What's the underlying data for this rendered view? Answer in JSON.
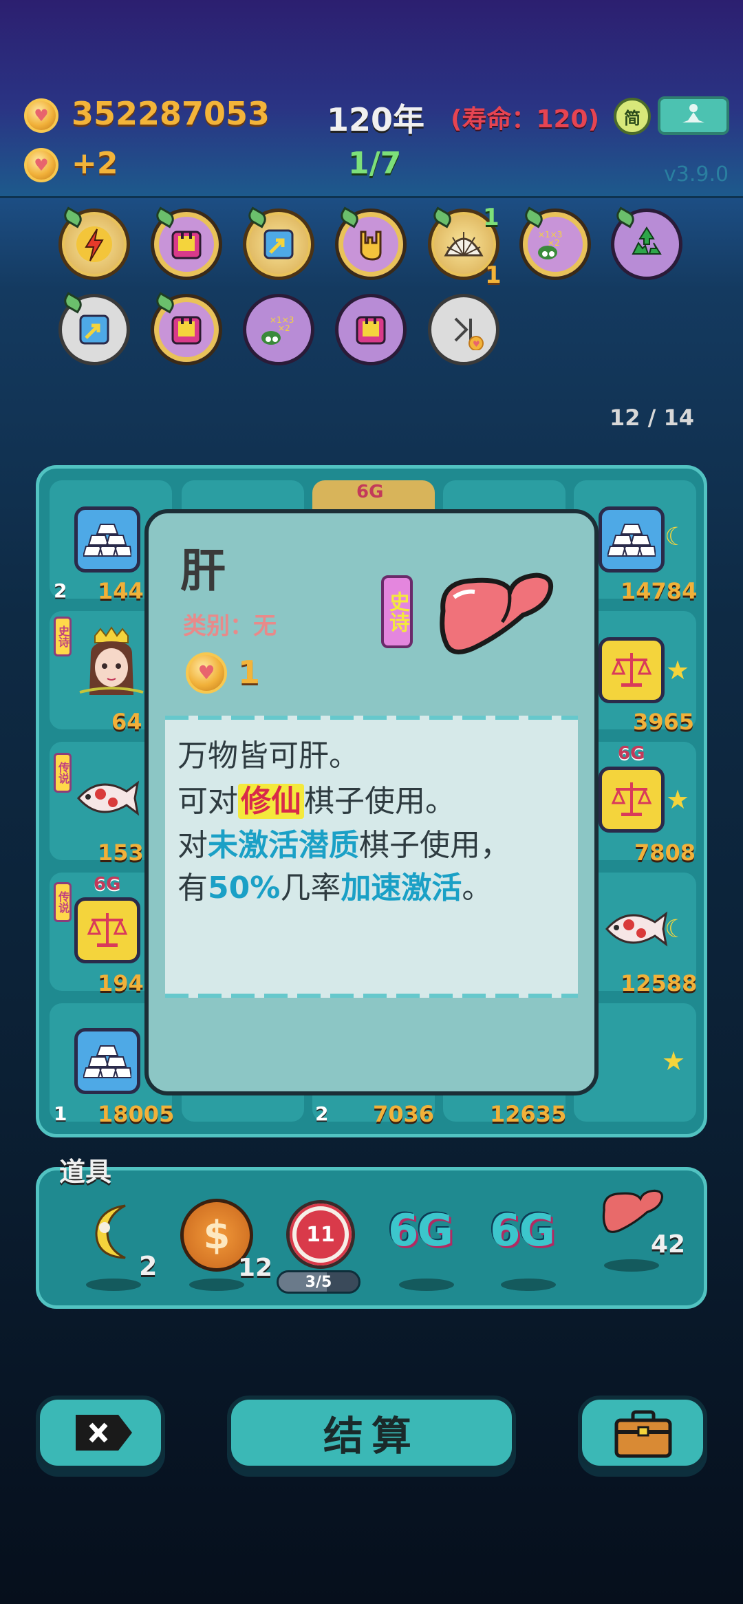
{
  "header": {
    "coins": "352287053",
    "coins_delta": "+2",
    "year": "120年",
    "lifespan": "(寿命：120)",
    "progress": "1/7",
    "lang_toggle": "简",
    "version": "v3.9.0"
  },
  "skills": {
    "shell_top_count": "1",
    "shell_bottom_count": "1"
  },
  "board": {
    "page": "12 / 14",
    "cells": {
      "r1c1_small": "2",
      "r1c1_num": "144",
      "r1c3_badge": "6G",
      "r1c5_num": "14784",
      "r2c1_num": "64",
      "r2c1_tag": "史诗",
      "r2c5_num": "3965",
      "r3c1_num": "153",
      "r3c1_tag": "传说",
      "r3c5_num": "7808",
      "r3c5_badge": "6G",
      "r4c1_num": "194",
      "r4c1_tag": "传说",
      "r4c1_badge": "6G",
      "r4c5_num": "12588",
      "r5c1_small": "1",
      "r5c1_num": "18005",
      "r5c3_small": "2",
      "r5c3_num": "7036",
      "r5c4_num": "12635"
    }
  },
  "popup": {
    "title": "肝",
    "category": "类别：无",
    "rarity": "史诗",
    "cost": "1",
    "line1": "万物皆可肝。",
    "line2_a": "可对",
    "line2_hl": "修仙",
    "line2_b": "棋子使用。",
    "line3_a": "对",
    "line3_hl": "未激活潜质",
    "line3_b": "棋子使用，",
    "line4_a": "有",
    "line4_hl1": "50%",
    "line4_b": "几率",
    "line4_hl2": "加速激活",
    "line4_c": "。"
  },
  "props": {
    "title": "道具",
    "items": [
      {
        "icon": "moon-icon",
        "count": "2"
      },
      {
        "icon": "dollar-coin-icon",
        "count": "12"
      },
      {
        "icon": "target-icon",
        "value": "11",
        "progress_text": "3/5",
        "progress": 0.6
      },
      {
        "icon": "6g-icon",
        "label": "6G"
      },
      {
        "icon": "6g-icon",
        "label": "6G"
      },
      {
        "icon": "liver-icon",
        "count": "42"
      }
    ]
  },
  "footer": {
    "settle_label": "结算"
  },
  "colors": {
    "gold": "#f3b43a",
    "red": "#e64452",
    "green": "#7de07a",
    "board": "#1f8a90",
    "popup": "#8cc6c5",
    "highlight_cyan": "#1aa0c6"
  }
}
